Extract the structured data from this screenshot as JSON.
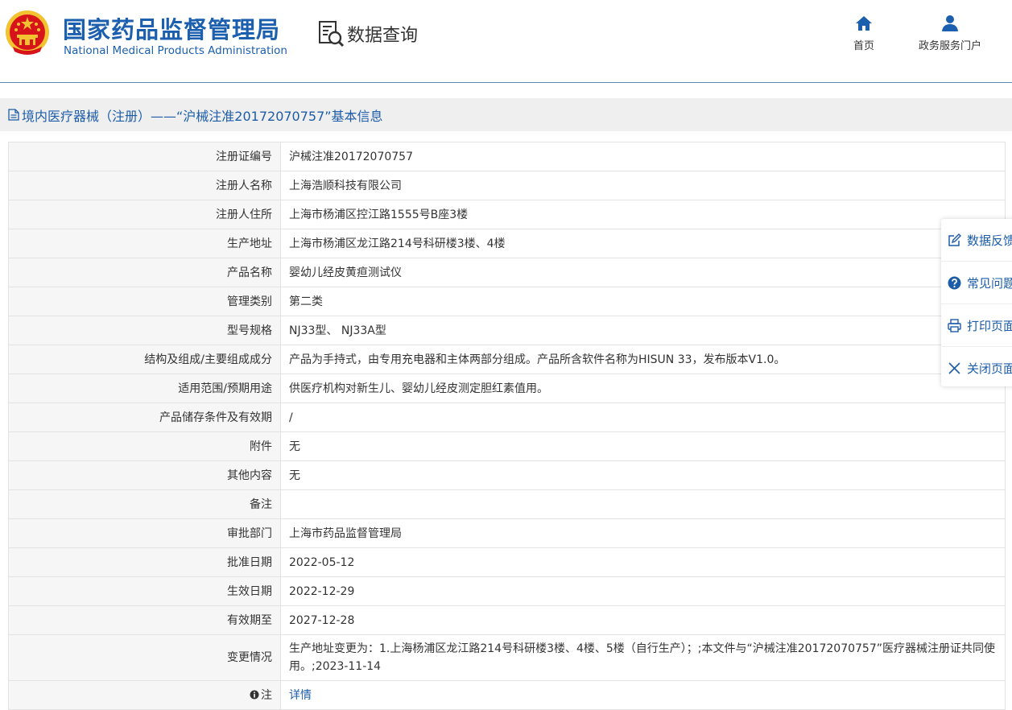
{
  "header": {
    "brand_cn": "国家药品监督管理局",
    "brand_en": "National Medical Products Administration",
    "query_title": "数据查询",
    "nav": [
      {
        "label": "首页",
        "icon": "home-icon"
      },
      {
        "label": "政务服务门户",
        "icon": "user-icon"
      }
    ]
  },
  "title_bar": {
    "text": "境内医疗器械（注册）——“沪械注准20172070757”基本信息"
  },
  "rows": [
    {
      "label": "注册证编号",
      "value": "沪械注准20172070757"
    },
    {
      "label": "注册人名称",
      "value": "上海浩顺科技有限公司"
    },
    {
      "label": "注册人住所",
      "value": "上海市杨浦区控江路1555号B座3楼"
    },
    {
      "label": "生产地址",
      "value": "上海市杨浦区龙江路214号科研楼3楼、4楼"
    },
    {
      "label": "产品名称",
      "value": "婴幼儿经皮黄疸测试仪"
    },
    {
      "label": "管理类别",
      "value": "第二类"
    },
    {
      "label": "型号规格",
      "value": "NJ33型、 NJ33A型"
    },
    {
      "label": "结构及组成/主要组成成分",
      "value": "产品为手持式，由专用充电器和主体两部分组成。产品所含软件名称为HISUN 33，发布版本V1.0。"
    },
    {
      "label": "适用范围/预期用途",
      "value": "供医疗机构对新生儿、婴幼儿经皮测定胆红素值用。"
    },
    {
      "label": "产品储存条件及有效期",
      "value": "/"
    },
    {
      "label": "附件",
      "value": "无"
    },
    {
      "label": "其他内容",
      "value": "无"
    },
    {
      "label": "备注",
      "value": ""
    },
    {
      "label": "审批部门",
      "value": "上海市药品监督管理局"
    },
    {
      "label": "批准日期",
      "value": "2022-05-12"
    },
    {
      "label": "生效日期",
      "value": "2022-12-29"
    },
    {
      "label": "有效期至",
      "value": "2027-12-28"
    },
    {
      "label": "变更情况",
      "value": "生产地址变更为：1.上海杨浦区龙江路214号科研楼3楼、4楼、5楼（自行生产）；;本文件与“沪械注准20172070757”医疗器械注册证共同使用。;2023-11-14"
    },
    {
      "label": "注",
      "value": "详情"
    }
  ],
  "side_panel": [
    {
      "label": "数据反馈",
      "icon": "edit-icon"
    },
    {
      "label": "常见问题",
      "icon": "question-icon"
    },
    {
      "label": "打印页面",
      "icon": "print-icon"
    },
    {
      "label": "关闭页面",
      "icon": "close-icon"
    }
  ],
  "colors": {
    "brand": "#1b5fae",
    "link": "#1c5ca8",
    "emblem_red": "#d7141a",
    "emblem_gold": "#f2c230"
  }
}
